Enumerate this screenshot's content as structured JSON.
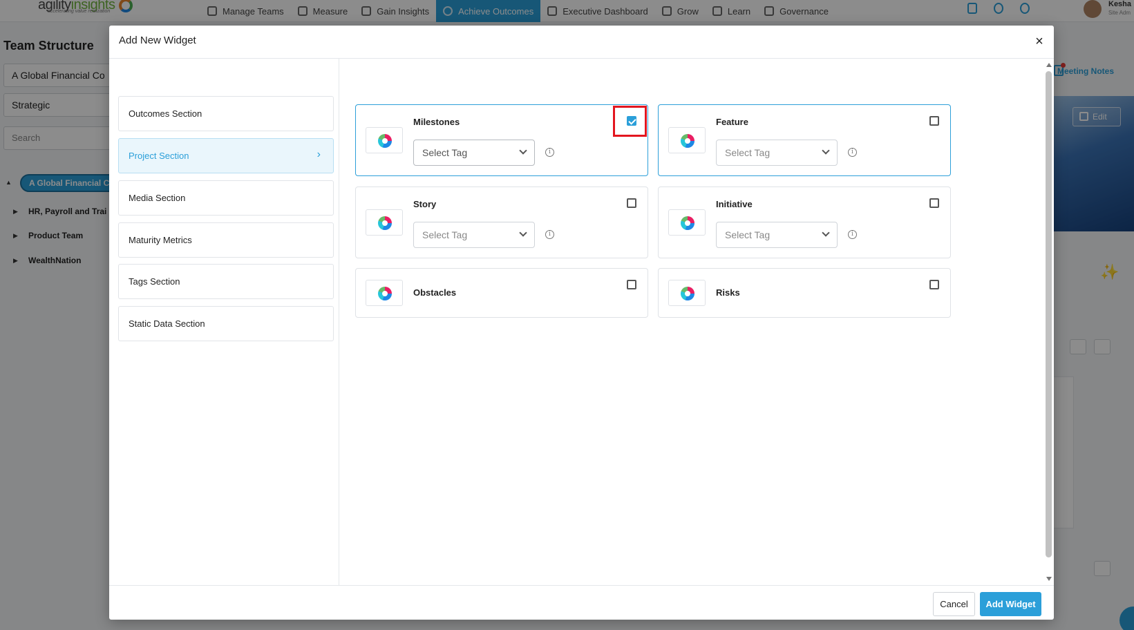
{
  "app": {
    "logo_text_1": "agility",
    "logo_text_2": "insights",
    "logo_tagline": "accelerating value realization"
  },
  "nav": [
    {
      "label": "Manage Teams",
      "icon": "team-icon"
    },
    {
      "label": "Measure",
      "icon": "measure-icon"
    },
    {
      "label": "Gain Insights",
      "icon": "insights-icon"
    },
    {
      "label": "Achieve Outcomes",
      "icon": "target-icon",
      "active": true
    },
    {
      "label": "Executive Dashboard",
      "icon": "dashboard-icon"
    },
    {
      "label": "Grow",
      "icon": "grow-icon"
    },
    {
      "label": "Learn",
      "icon": "graduation-cap-icon"
    },
    {
      "label": "Governance",
      "icon": "hierarchy-icon"
    }
  ],
  "user": {
    "name": "Kesha",
    "role": "Site Adm"
  },
  "sidebar": {
    "title": "Team Structure",
    "org_select": "A Global Financial Co",
    "level_select": "Strategic",
    "search_placeholder": "Search",
    "tree_root": "A Global Financial C",
    "tree_items": [
      "HR, Payroll and Trai",
      "Product Team",
      "WealthNation"
    ]
  },
  "right_panel": {
    "meeting_notes": "Meeting Notes",
    "edit_label": "Edit",
    "sparkle": "✨"
  },
  "modal": {
    "title": "Add New Widget",
    "close": "×",
    "sections": [
      {
        "label": "Outcomes Section"
      },
      {
        "label": "Project Section",
        "active": true
      },
      {
        "label": "Media Section"
      },
      {
        "label": "Maturity Metrics"
      },
      {
        "label": "Tags Section"
      },
      {
        "label": "Static Data Section"
      }
    ],
    "chevron": "›",
    "widgets": [
      {
        "title": "Milestones",
        "checked": true,
        "select": "Select Tag"
      },
      {
        "title": "Feature",
        "checked": false,
        "select": "Select Tag"
      },
      {
        "title": "Story",
        "checked": false,
        "select": "Select Tag"
      },
      {
        "title": "Initiative",
        "checked": false,
        "select": "Select Tag"
      },
      {
        "title": "Obstacles",
        "checked": false
      },
      {
        "title": "Risks",
        "checked": false
      }
    ],
    "info_glyph": "i",
    "cancel_label": "Cancel",
    "add_label": "Add Widget"
  },
  "colors": {
    "accent": "#2b9fd9",
    "highlight": "#e3161f"
  }
}
